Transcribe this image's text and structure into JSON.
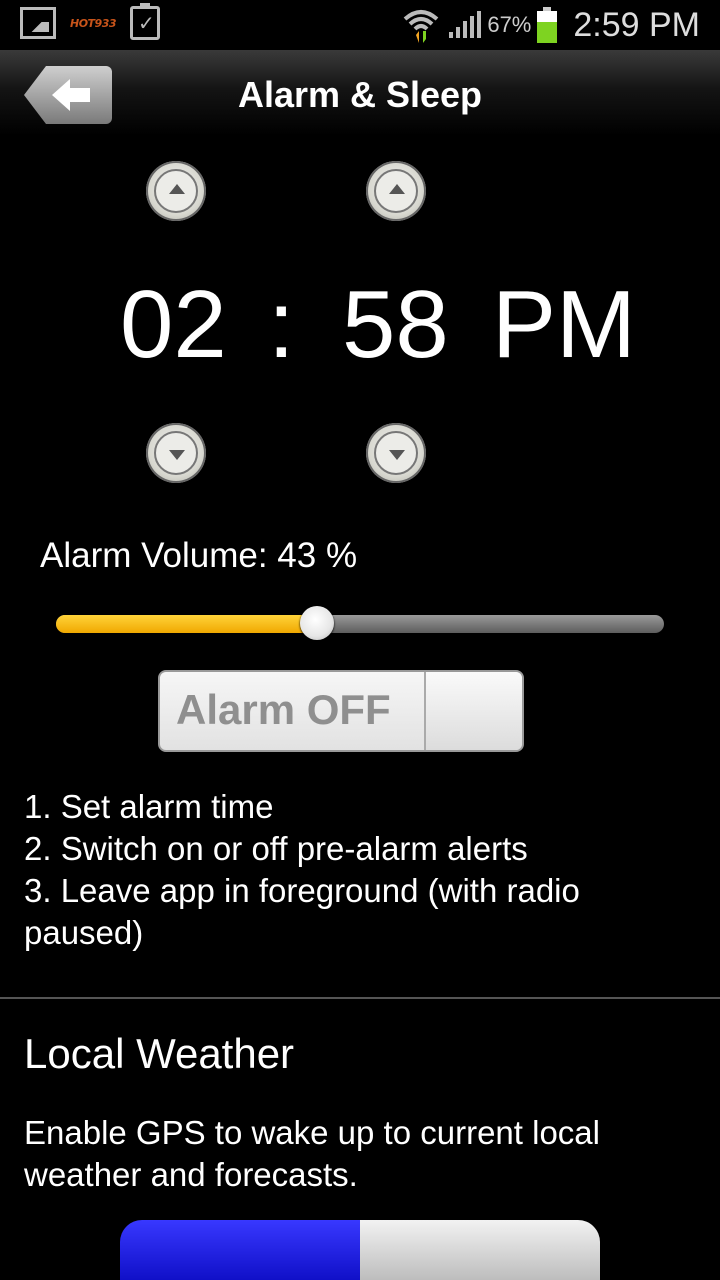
{
  "status_bar": {
    "notification_text": "HOT933",
    "battery_percent": "67%",
    "battery_level": 0.67,
    "time": "2:59 PM"
  },
  "header": {
    "title": "Alarm & Sleep",
    "back_icon": "back-arrow-icon"
  },
  "alarm_time": {
    "hours": "02",
    "separator": ":",
    "minutes": "58",
    "period": "PM"
  },
  "volume": {
    "label": "Alarm Volume: 43 %",
    "value_percent": 43,
    "accent_color": "#f0a800"
  },
  "alarm_toggle": {
    "label": "Alarm OFF",
    "state": "off"
  },
  "instructions": [
    "1. Set alarm time",
    "2. Switch on or off pre-alarm alerts",
    "3. Leave app in foreground (with radio",
    "paused)"
  ],
  "weather": {
    "title": "Local Weather",
    "description": "Enable GPS to wake up to current local weather and forecasts.",
    "toggle_accent": "#1a1aff"
  }
}
